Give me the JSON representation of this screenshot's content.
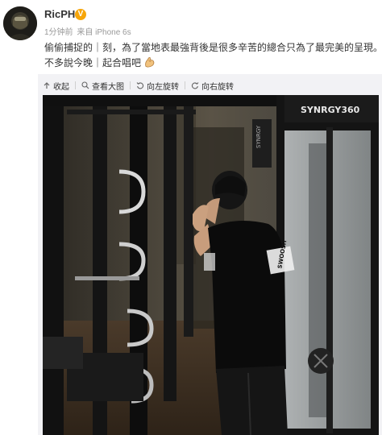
{
  "post": {
    "username": "RicPH",
    "verified_badge": "V",
    "time": "1分钟前",
    "source": "来自 iPhone 6s",
    "text_line1": "偷偷捕捉的｜刻，為了當地表最強背後是很多辛苦的總合只為了最完美的呈現。",
    "text_line2": "不多說今晚｜起合唱吧",
    "emoji": "flexed-biceps"
  },
  "toolbar": {
    "collect": "收起",
    "view_large": "查看大图",
    "rotate_left": "向左旋转",
    "rotate_right": "向右旋转"
  },
  "photo": {
    "machine_brand": "SYNRGY360",
    "shirt_text": "SWOOSH"
  },
  "colors": {
    "badge": "#f7a60a",
    "muted": "#999999",
    "media_bg": "#f2f2f5"
  }
}
